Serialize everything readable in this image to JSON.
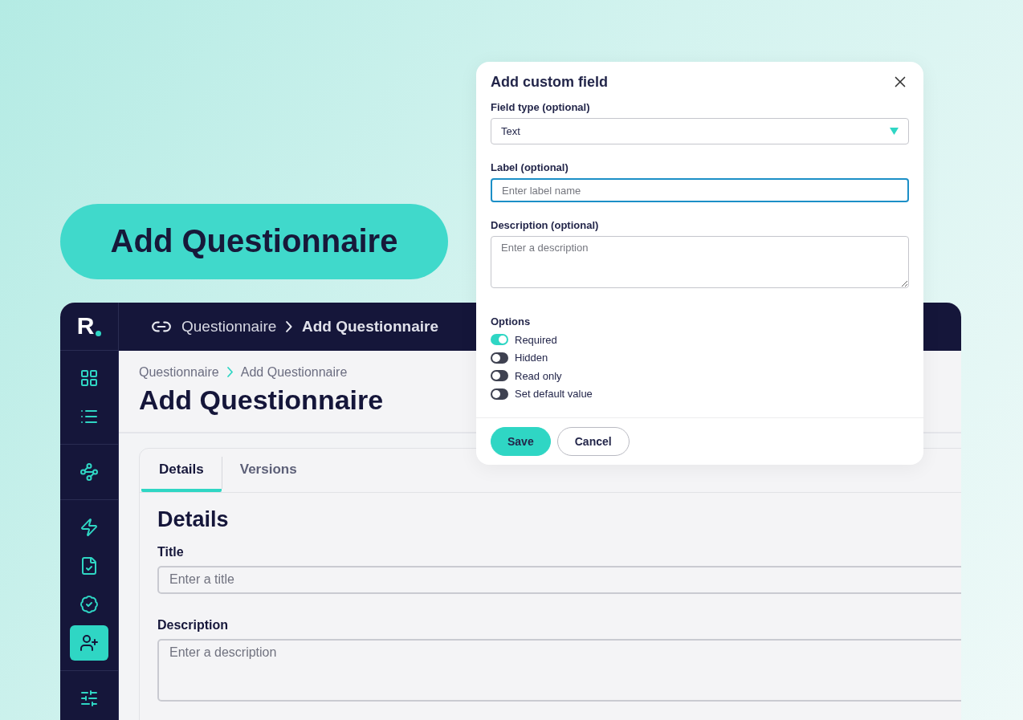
{
  "hero_label": "Add Questionnaire",
  "app": {
    "logo": "R",
    "topbar_breadcrumb": [
      {
        "label": "Questionnaire",
        "current": false
      },
      {
        "label": "Add Questionnaire",
        "current": true
      }
    ],
    "sidebar_groups": [
      [
        {
          "selected": false
        },
        {
          "selected": false
        }
      ],
      [
        {
          "selected": false
        }
      ],
      [
        {
          "selected": false
        },
        {
          "selected": false
        },
        {
          "selected": false
        },
        {
          "selected": true
        }
      ],
      [
        {
          "selected": false
        }
      ]
    ],
    "breadcrumb": [
      {
        "label": "Questionnaire"
      },
      {
        "label": "Add Questionnaire"
      }
    ],
    "title": "Add Questionnaire",
    "tabs": [
      {
        "label": "Details",
        "selected": true
      },
      {
        "label": "Versions",
        "selected": false
      }
    ],
    "section_title": "Details",
    "fields": [
      {
        "kind": "input",
        "label": "Title",
        "placeholder": "Enter a title"
      },
      {
        "kind": "textarea",
        "label": "Description",
        "placeholder": "Enter a description"
      }
    ]
  },
  "dialog": {
    "title": "Add custom field",
    "fields": [
      {
        "kind": "select",
        "label": "Field type (optional)",
        "value": "Text",
        "focused": false
      },
      {
        "kind": "input",
        "label": "Label (optional)",
        "placeholder": "Enter label name",
        "focused": true
      },
      {
        "kind": "textarea",
        "label": "Description (optional)",
        "placeholder": "Enter a description",
        "focused": false
      }
    ],
    "options_label": "Options",
    "options": [
      {
        "label": "Required",
        "on": true
      },
      {
        "label": "Hidden",
        "on": false
      },
      {
        "label": "Read only",
        "on": false
      },
      {
        "label": "Set default value",
        "on": false
      }
    ],
    "buttons": [
      {
        "label": "Save",
        "kind": "primary"
      },
      {
        "label": "Cancel",
        "kind": "secondary"
      }
    ]
  }
}
